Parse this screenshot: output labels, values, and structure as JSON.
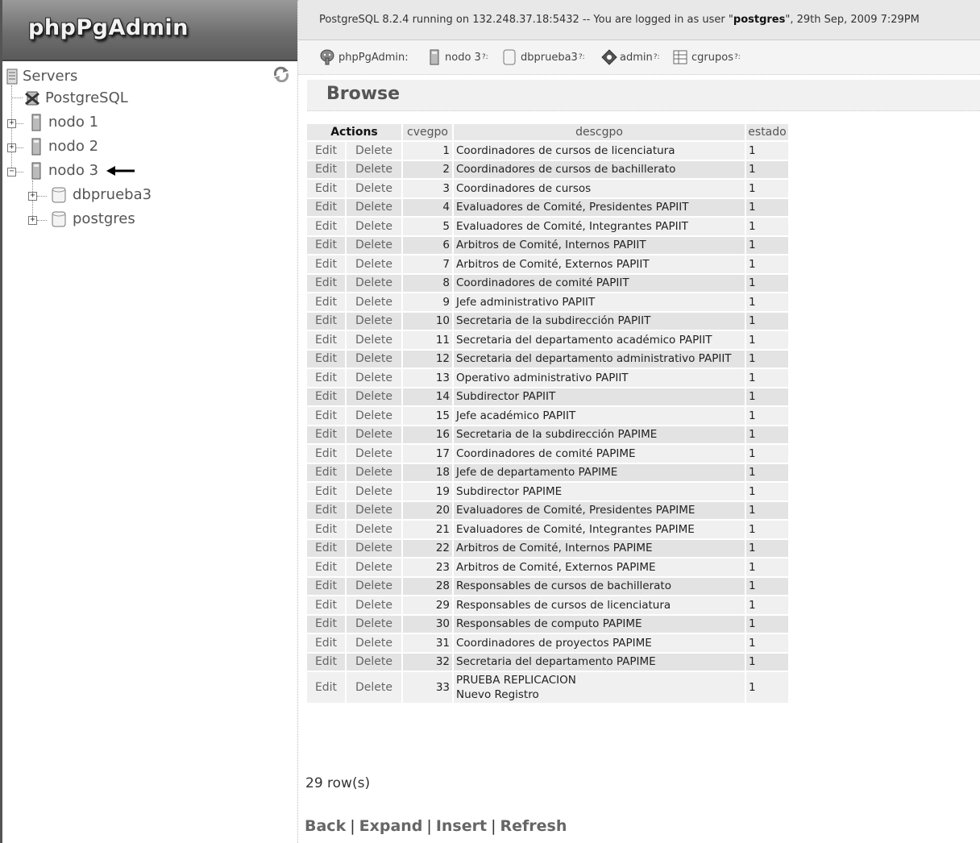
{
  "app": {
    "logo": "phpPgAdmin"
  },
  "topbar": {
    "prefix": "PostgreSQL 8.2.4 running on 132.248.37.18:5432 -- You are logged in as user \"",
    "user": "postgres",
    "suffix": "\", 29th Sep, 2009 7:29PM"
  },
  "trail": [
    {
      "label": "phpPgAdmin:",
      "icon": "elephant-icon"
    },
    {
      "label": "nodo 3",
      "icon": "server-icon",
      "sep": "?:"
    },
    {
      "label": "dbprueba3",
      "icon": "database-icon",
      "sep": "?:"
    },
    {
      "label": "admin",
      "icon": "schema-icon",
      "sep": "?:"
    },
    {
      "label": "cgrupos",
      "icon": "table-icon",
      "sep": "?:"
    }
  ],
  "tree": {
    "root": "Servers",
    "items": [
      {
        "label": "PostgreSQL",
        "icon": "disconnected-server-icon"
      },
      {
        "label": "nodo 1",
        "icon": "server-icon"
      },
      {
        "label": "nodo 2",
        "icon": "server-icon"
      },
      {
        "label": "nodo 3",
        "icon": "server-icon"
      },
      {
        "label": "dbprueba3",
        "icon": "database-icon"
      },
      {
        "label": "postgres",
        "icon": "database-icon"
      }
    ]
  },
  "page_title": "Browse",
  "table": {
    "headers": [
      "Actions",
      "cvegpo",
      "descgpo",
      "estado"
    ],
    "edit_label": "Edit",
    "delete_label": "Delete",
    "rows": [
      {
        "cvegpo": "1",
        "descgpo": "Coordinadores de cursos de licenciatura",
        "estado": "1"
      },
      {
        "cvegpo": "2",
        "descgpo": "Coordinadores de cursos de bachillerato",
        "estado": "1"
      },
      {
        "cvegpo": "3",
        "descgpo": "Coordinadores de cursos",
        "estado": "1"
      },
      {
        "cvegpo": "4",
        "descgpo": "Evaluadores de Comité, Presidentes PAPIIT",
        "estado": "1"
      },
      {
        "cvegpo": "5",
        "descgpo": "Evaluadores de Comité, Integrantes PAPIIT",
        "estado": "1"
      },
      {
        "cvegpo": "6",
        "descgpo": "Arbitros de Comité, Internos PAPIIT",
        "estado": "1"
      },
      {
        "cvegpo": "7",
        "descgpo": "Arbitros de Comité, Externos PAPIIT",
        "estado": "1"
      },
      {
        "cvegpo": "8",
        "descgpo": "Coordinadores de comité PAPIIT",
        "estado": "1"
      },
      {
        "cvegpo": "9",
        "descgpo": "Jefe administrativo PAPIIT",
        "estado": "1"
      },
      {
        "cvegpo": "10",
        "descgpo": "Secretaria de la subdirección PAPIIT",
        "estado": "1"
      },
      {
        "cvegpo": "11",
        "descgpo": "Secretaria del departamento académico PAPIIT",
        "estado": "1"
      },
      {
        "cvegpo": "12",
        "descgpo": "Secretaria del departamento administrativo PAPIIT",
        "estado": "1"
      },
      {
        "cvegpo": "13",
        "descgpo": "Operativo administrativo PAPIIT",
        "estado": "1"
      },
      {
        "cvegpo": "14",
        "descgpo": "Subdirector PAPIIT",
        "estado": "1"
      },
      {
        "cvegpo": "15",
        "descgpo": "Jefe académico PAPIIT",
        "estado": "1"
      },
      {
        "cvegpo": "16",
        "descgpo": "Secretaria de la subdirección PAPIME",
        "estado": "1"
      },
      {
        "cvegpo": "17",
        "descgpo": "Coordinadores de comité PAPIME",
        "estado": "1"
      },
      {
        "cvegpo": "18",
        "descgpo": "Jefe de departamento PAPIME",
        "estado": "1"
      },
      {
        "cvegpo": "19",
        "descgpo": "Subdirector PAPIME",
        "estado": "1"
      },
      {
        "cvegpo": "20",
        "descgpo": "Evaluadores de Comité, Presidentes PAPIME",
        "estado": "1"
      },
      {
        "cvegpo": "21",
        "descgpo": "Evaluadores de Comité, Integrantes PAPIME",
        "estado": "1"
      },
      {
        "cvegpo": "22",
        "descgpo": "Arbitros de Comité, Internos PAPIME",
        "estado": "1"
      },
      {
        "cvegpo": "23",
        "descgpo": "Arbitros de Comité, Externos PAPIME",
        "estado": "1"
      },
      {
        "cvegpo": "28",
        "descgpo": "Responsables de cursos de bachillerato",
        "estado": "1"
      },
      {
        "cvegpo": "29",
        "descgpo": "Responsables de cursos de licenciatura",
        "estado": "1"
      },
      {
        "cvegpo": "30",
        "descgpo": "Responsables de computo PAPIME",
        "estado": "1"
      },
      {
        "cvegpo": "31",
        "descgpo": "Coordinadores de proyectos PAPIME",
        "estado": "1"
      },
      {
        "cvegpo": "32",
        "descgpo": "Secretaria del departamento PAPIME",
        "estado": "1"
      },
      {
        "cvegpo": "33",
        "descgpo": "PRUEBA REPLICACION\nNuevo Registro",
        "estado": "1"
      }
    ]
  },
  "row_count": "29 row(s)",
  "nav": {
    "back": "Back",
    "expand": "Expand",
    "insert": "Insert",
    "refresh": "Refresh"
  }
}
